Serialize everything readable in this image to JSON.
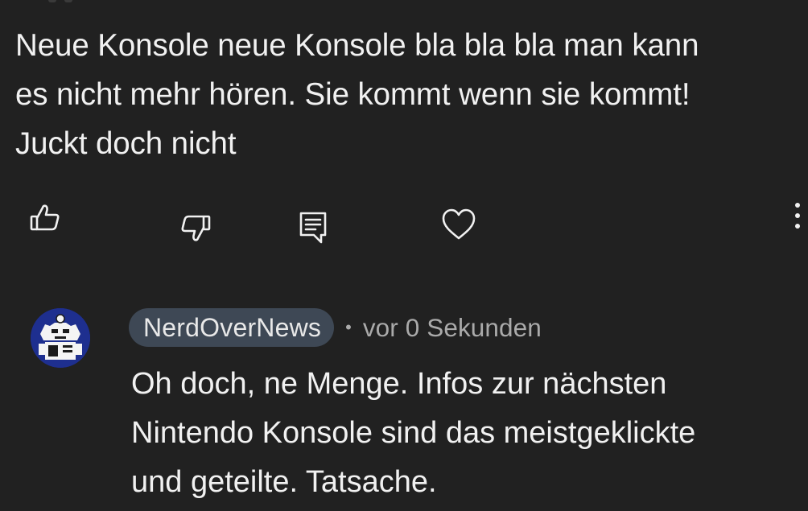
{
  "comment": {
    "text": "Neue Konsole neue Konsole bla bla bla man kann\nes nicht mehr hören. Sie kommt wenn sie kommt!\nJuckt doch nicht"
  },
  "actions": {
    "like_icon": "thumbs-up-icon",
    "dislike_icon": "thumbs-down-icon",
    "reply_icon": "comment-reply-icon",
    "heart_icon": "heart-icon",
    "more_icon": "more-vertical-icon"
  },
  "reply": {
    "author": "NerdOverNews",
    "separator": "•",
    "timestamp": "vor 0 Sekunden",
    "text": "Oh doch, ne Menge. Infos zur nächsten\nNintendo Konsole sind das meistgeklickte\nund geteilte. Tatsache."
  },
  "colors": {
    "background": "#212121",
    "text": "#f1f1f1",
    "secondary_text": "#aaaaaa",
    "author_pill": "#3e4855",
    "avatar_bg": "#1e2f8f"
  }
}
